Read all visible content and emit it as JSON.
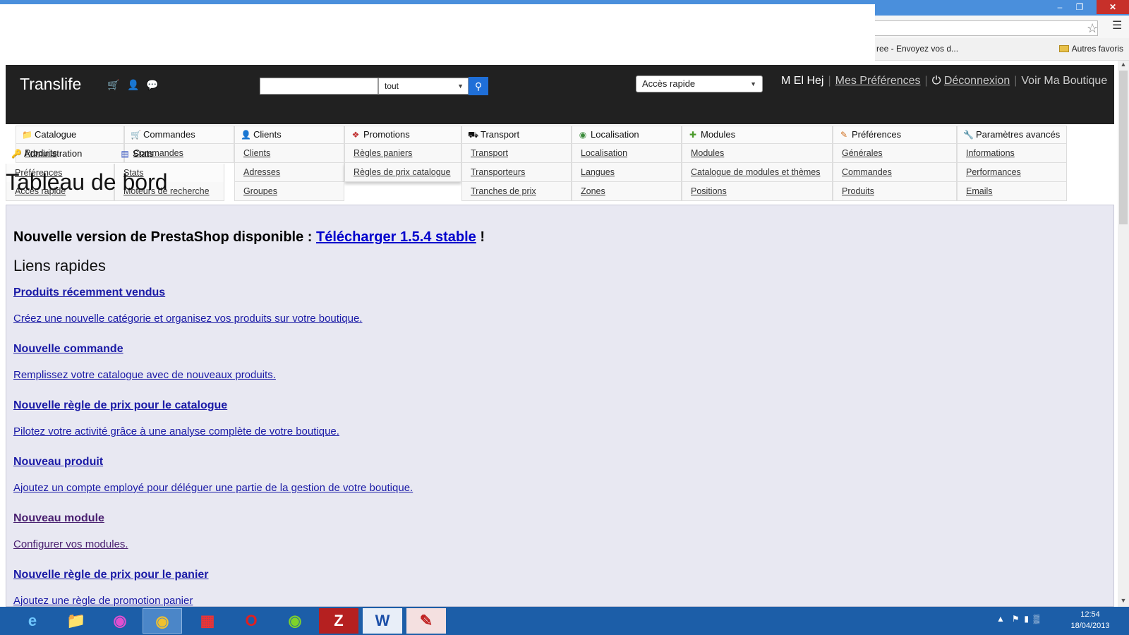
{
  "browser": {
    "bookmark_item": "ree - Envoyez vos d...",
    "other_bookmarks": "Autres favoris"
  },
  "header": {
    "shop_name": "Translife",
    "search_scope": "tout",
    "quick_access": "Accès rapide",
    "user_name": "M El Hej",
    "preferences_link": "Mes Préférences",
    "logout_link": "Déconnexion",
    "view_shop_link": "Voir Ma Boutique"
  },
  "tabs": [
    {
      "label": "Catalogue",
      "icon": "folder-icon"
    },
    {
      "label": "Commandes",
      "icon": "cart-icon"
    },
    {
      "label": "Clients",
      "icon": "user-icon"
    },
    {
      "label": "Promotions",
      "icon": "promo-icon"
    },
    {
      "label": "Transport",
      "icon": "truck-icon"
    },
    {
      "label": "Localisation",
      "icon": "globe-icon"
    },
    {
      "label": "Modules",
      "icon": "puzzle-icon"
    },
    {
      "label": "Préférences",
      "icon": "preferences-icon"
    },
    {
      "label": "Paramètres avancés",
      "icon": "wrench-icon"
    },
    {
      "label": "Administration",
      "icon": "key-icon"
    },
    {
      "label": "Stats",
      "icon": "chart-icon"
    }
  ],
  "submenus": {
    "catalogue": [
      "Produits"
    ],
    "commandes": [
      "Commandes"
    ],
    "clients": [
      "Clients",
      "Adresses",
      "Groupes"
    ],
    "promotions": [
      "Règles paniers",
      "Règles de prix catalogue"
    ],
    "transport": [
      "Transport",
      "Transporteurs",
      "Tranches de prix"
    ],
    "localisation": [
      "Localisation",
      "Langues",
      "Zones"
    ],
    "modules": [
      "Modules",
      "Catalogue de modules et thèmes",
      "Positions"
    ],
    "preferences": [
      "Générales",
      "Commandes",
      "Produits"
    ],
    "parametres": [
      "Informations",
      "Performances",
      "Emails"
    ],
    "administration": [
      "Préférences",
      "Accès rapide"
    ],
    "stats": [
      "Stats",
      "Moteurs de recherche"
    ]
  },
  "page_title": "Tableau de bord",
  "version_notice": {
    "prefix": "Nouvelle version de PrestaShop disponible :",
    "link": "Télécharger 1.5.4 stable",
    "suffix": "!"
  },
  "quick_links_title": "Liens rapides",
  "quick_links": [
    {
      "title": "Produits récemment vendus",
      "desc": "Créez une nouvelle catégorie et organisez vos produits sur votre boutique."
    },
    {
      "title": "Nouvelle commande",
      "desc": "Remplissez votre catalogue avec de nouveaux produits."
    },
    {
      "title": "Nouvelle règle de prix pour le catalogue",
      "desc": "Pilotez votre activité grâce à une analyse complète de votre boutique."
    },
    {
      "title": "Nouveau produit",
      "desc": "Ajoutez un compte employé pour déléguer une partie de la gestion de votre boutique."
    },
    {
      "title": "Nouveau module",
      "desc": "Configurer vos modules."
    },
    {
      "title": "Nouvelle règle de prix pour le panier",
      "desc": "Ajoutez une règle de promotion panier"
    }
  ],
  "taskbar": {
    "apps": [
      "ie-icon",
      "explorer-icon",
      "app-icon",
      "chrome-icon",
      "windows-icon",
      "opera-icon",
      "spotify-icon",
      "filezilla-icon",
      "word-icon",
      "acrobat-icon"
    ],
    "time": "12:54",
    "date": "18/04/2013"
  }
}
